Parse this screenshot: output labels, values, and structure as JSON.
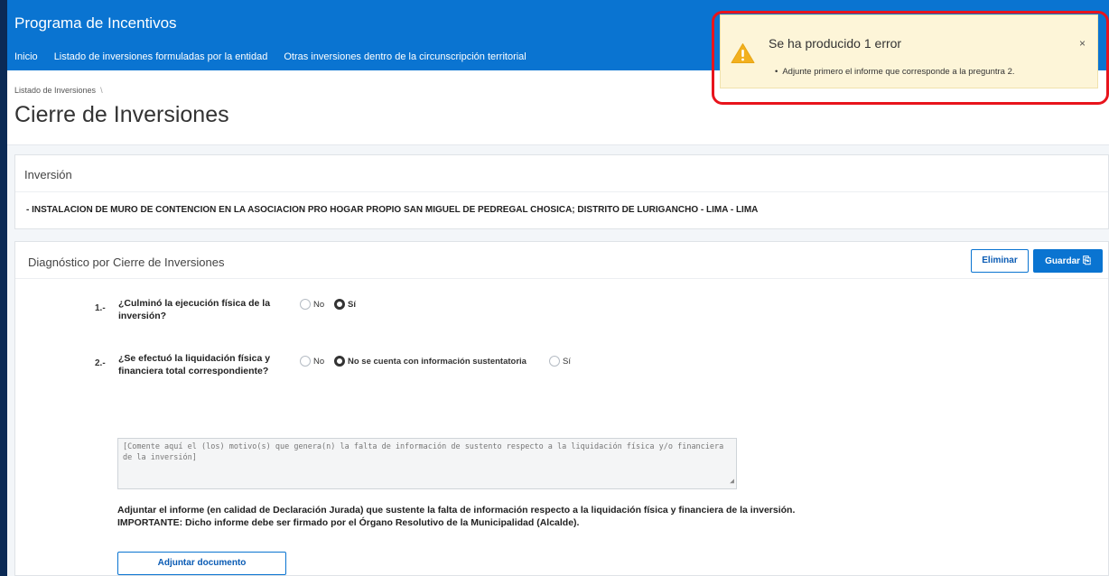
{
  "app": {
    "title": "Programa de Incentivos"
  },
  "nav": {
    "items": [
      "Inicio",
      "Listado de inversiones formuladas por la entidad",
      "Otras inversiones dentro de la circunscripción territorial"
    ]
  },
  "breadcrumb": {
    "items": [
      "Listado de Inversiones"
    ],
    "separator": "\\"
  },
  "page": {
    "title": "Cierre de Inversiones"
  },
  "investment": {
    "heading": "Inversión",
    "name": "- INSTALACION DE MURO DE CONTENCION EN LA ASOCIACION PRO HOGAR PROPIO SAN MIGUEL DE PEDREGAL CHOSICA; DISTRITO DE LURIGANCHO - LIMA - LIMA"
  },
  "diagnostic": {
    "heading": "Diagnóstico por Cierre de Inversiones",
    "delete_label": "Eliminar",
    "save_label": "Guardar",
    "questions": [
      {
        "number": "1.-",
        "text": "¿Culminó la ejecución física de la inversión?",
        "options": [
          {
            "label": "No",
            "selected": false
          },
          {
            "label": "Sí",
            "selected": true
          }
        ]
      },
      {
        "number": "2.-",
        "text": "¿Se efectuó la liquidación física y financiera total correspondiente?",
        "options": [
          {
            "label": "No",
            "selected": false
          },
          {
            "label": "No se cuenta con información sustentatoria",
            "selected": true
          },
          {
            "label": "Sí",
            "selected": false
          }
        ]
      }
    ],
    "comment_placeholder": "[Comente aquí el (los) motivo(s) que genera(n) la falta de información de sustento respecto a la liquidación física y/o financiera de la inversión]",
    "attach_text": "Adjuntar el informe (en calidad de Declaración Jurada) que sustente la falta de información respecto a la liquidación física y financiera de la inversión.",
    "important_text": "IMPORTANTE: Dicho informe debe ser firmado por el Órgano Resolutivo de la Municipalidad (Alcalde).",
    "attach_button_label": "Adjuntar documento"
  },
  "toast": {
    "title": "Se ha producido 1 error",
    "message": "Adjunte primero el informe que corresponde a la preguntra 2.",
    "close_symbol": "×",
    "icon": "warning-icon"
  },
  "colors": {
    "header": "#0a74d1",
    "accent": "#0a74d1",
    "toast_bg": "#fdf5d8",
    "warning": "#f2b01e",
    "highlight": "#e8141c"
  }
}
